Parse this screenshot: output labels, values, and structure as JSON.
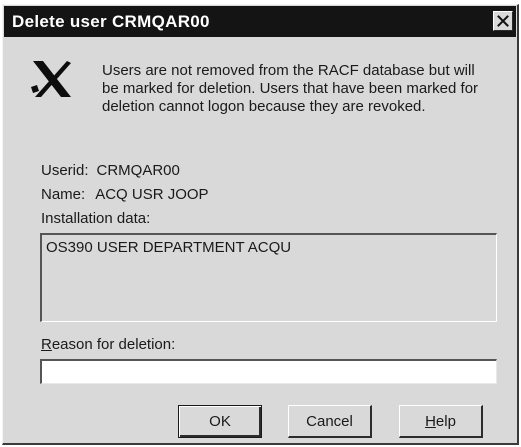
{
  "window": {
    "title": "Delete user CRMQAR00",
    "close_glyph": "✕"
  },
  "icons": {
    "warning": "x-mark-icon",
    "close": "close-icon"
  },
  "message": "Users are not removed from the RACF database but will be marked for deletion. Users that have been marked for deletion cannot logon because they are revoked.",
  "userid": {
    "label": "Userid:",
    "value": "CRMQAR00"
  },
  "name": {
    "label": "Name:",
    "value": "ACQ USR JOOP"
  },
  "installation": {
    "label": "Installation data:",
    "value": "OS390 USER DEPARTMENT ACQU"
  },
  "reason": {
    "label_mnemonic": "R",
    "label_rest": "eason for deletion:",
    "value": "",
    "placeholder": ""
  },
  "buttons": {
    "ok": {
      "label": "OK"
    },
    "cancel": {
      "label": "Cancel"
    },
    "help": {
      "mnemonic": "H",
      "rest": "elp"
    }
  },
  "colors": {
    "dialog_bg": "#d9d9d9",
    "titlebar_bg": "#141414",
    "titlebar_text": "#ffffff",
    "input_bg": "#ffffff"
  }
}
